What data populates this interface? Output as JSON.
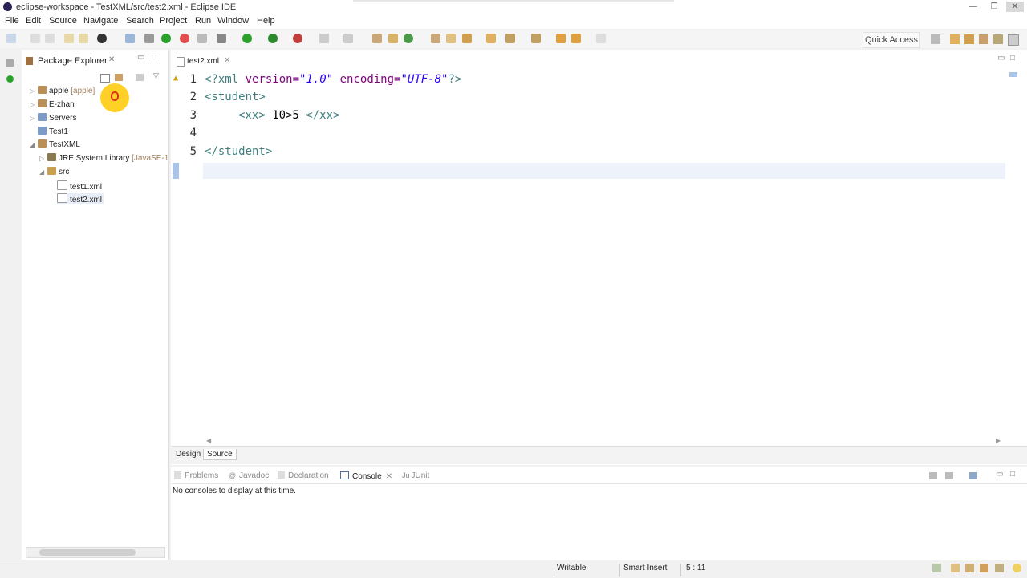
{
  "window": {
    "title": "eclipse-workspace - TestXML/src/test2.xml - Eclipse IDE"
  },
  "menu": [
    "File",
    "Edit",
    "Source",
    "Navigate",
    "Search",
    "Project",
    "Run",
    "Window",
    "Help"
  ],
  "toolbar": {
    "quick_access": "Quick Access"
  },
  "package_explorer": {
    "title": "Package Explorer",
    "items": [
      {
        "label": "apple",
        "extra": "[apple]"
      },
      {
        "label": "E-zhan",
        "extra": ""
      },
      {
        "label": "Servers",
        "extra": ""
      },
      {
        "label": "Test1",
        "extra": ""
      },
      {
        "label": "TestXML",
        "extra": ""
      },
      {
        "label": "JRE System Library",
        "extra": "[JavaSE-1"
      },
      {
        "label": "src",
        "extra": ""
      },
      {
        "label": "test1.xml",
        "extra": ""
      },
      {
        "label": "test2.xml",
        "extra": ""
      }
    ]
  },
  "editor": {
    "tab": "test2.xml",
    "line_numbers": [
      "1",
      "2",
      "3",
      "4",
      "5"
    ],
    "lines": {
      "l1a": "<?xml ",
      "l1b": "version=",
      "l1c": "\"1.0\"",
      "l1d": " encoding=",
      "l1e": "\"UTF-8\"",
      "l1f": "?>",
      "l2": "<student>",
      "l3a": "<xx>",
      "l3b": " 10>5 ",
      "l3c": "</xx>",
      "l5": "</student>"
    },
    "bottom_tabs": [
      "Design",
      "Source"
    ]
  },
  "console": {
    "tabs": [
      "Problems",
      "Javadoc",
      "Declaration",
      "Console",
      "JUnit"
    ],
    "message": "No consoles to display at this time."
  },
  "status": {
    "writable": "Writable",
    "insert": "Smart Insert",
    "position": "5 : 11"
  }
}
